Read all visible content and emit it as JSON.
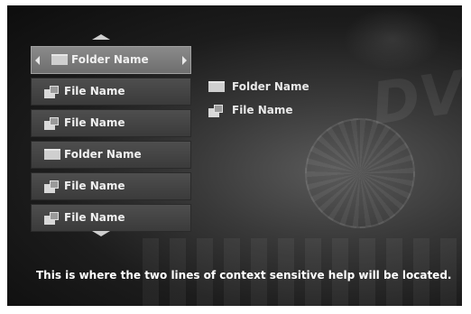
{
  "menu": {
    "items": [
      {
        "type": "folder",
        "label": "Folder Name",
        "selected": true
      },
      {
        "type": "file",
        "label": "File Name"
      },
      {
        "type": "file",
        "label": "File Name"
      },
      {
        "type": "folder",
        "label": "Folder Name"
      },
      {
        "type": "file",
        "label": "File Name"
      },
      {
        "type": "file",
        "label": "File Name"
      }
    ]
  },
  "preview": {
    "items": [
      {
        "type": "folder",
        "label": "Folder Name"
      },
      {
        "type": "file",
        "label": "File Name"
      }
    ]
  },
  "help_text": "This is where the two lines of context sensitive help will be located.",
  "colors": {
    "background": "#1c1c1c",
    "selected_item": "#7a7a7a",
    "item": "#444444",
    "text": "#f0f0f0"
  }
}
